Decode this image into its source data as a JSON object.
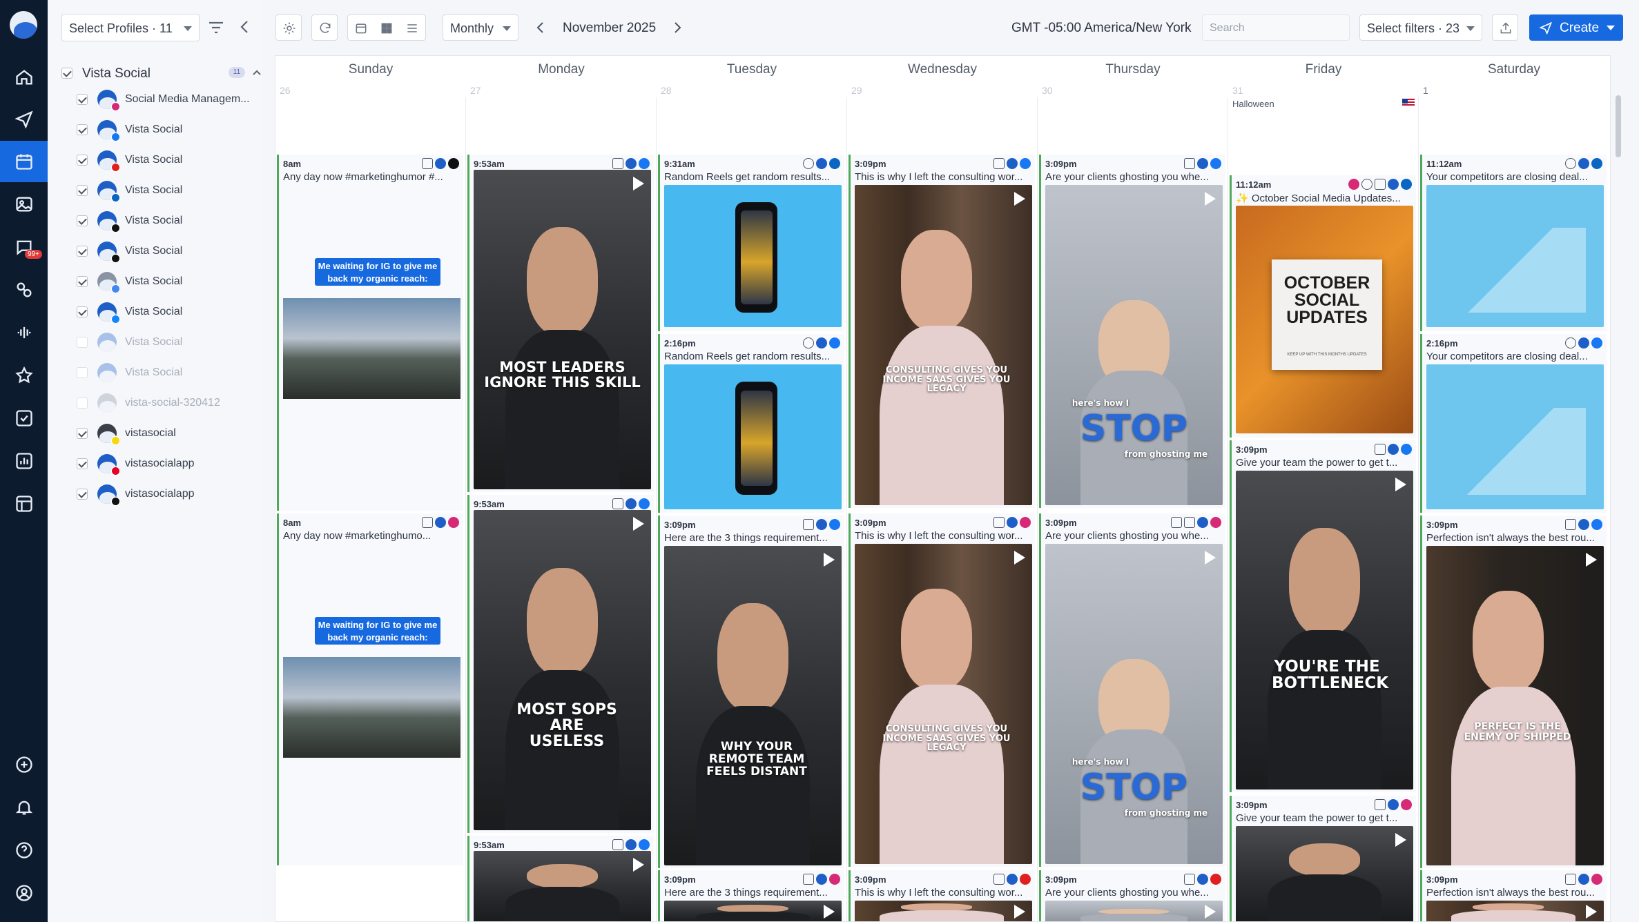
{
  "sidebar_nav": [
    {
      "icon": "home-icon"
    },
    {
      "icon": "send-icon"
    },
    {
      "icon": "calendar-icon",
      "active": true
    },
    {
      "icon": "media-library-icon"
    },
    {
      "icon": "inbox-icon",
      "badge": "99+"
    },
    {
      "icon": "integrations-icon"
    },
    {
      "icon": "listening-icon"
    },
    {
      "icon": "reviews-icon"
    },
    {
      "icon": "tasks-icon"
    },
    {
      "icon": "reports-icon"
    },
    {
      "icon": "workspace-icon"
    }
  ],
  "sidebar_bottom": [
    {
      "icon": "add-icon"
    },
    {
      "icon": "notifications-icon"
    },
    {
      "icon": "help-icon"
    },
    {
      "icon": "account-icon"
    }
  ],
  "profiles_panel": {
    "select_label": "Select Profiles · 11",
    "group": {
      "name": "Vista Social",
      "count": "11"
    },
    "profiles": [
      {
        "label": "Social Media Managem...",
        "checked": true,
        "network": "instagram"
      },
      {
        "label": "Vista Social",
        "checked": true,
        "network": "facebook"
      },
      {
        "label": "Vista Social",
        "checked": true,
        "network": "youtube"
      },
      {
        "label": "Vista Social",
        "checked": true,
        "network": "linkedin"
      },
      {
        "label": "Vista Social",
        "checked": true,
        "network": "x"
      },
      {
        "label": "Vista Social",
        "checked": true,
        "network": "tiktok"
      },
      {
        "label": "Vista Social",
        "checked": true,
        "network": "google"
      },
      {
        "label": "Vista Social",
        "checked": true,
        "network": "bluesky"
      },
      {
        "label": "Vista Social",
        "checked": false,
        "network": "threads"
      },
      {
        "label": "Vista Social",
        "checked": false,
        "network": "other"
      },
      {
        "label": "vista-social-320412",
        "checked": false,
        "network": "google"
      },
      {
        "label": "vistasocial",
        "checked": true,
        "network": "snapchat"
      },
      {
        "label": "vistasocialapp",
        "checked": true,
        "network": "pinterest"
      },
      {
        "label": "vistasocialapp",
        "checked": true,
        "network": "threads"
      }
    ]
  },
  "toolbar": {
    "view": "Monthly",
    "month": "November 2025",
    "timezone": "GMT -05:00 America/New York",
    "search_placeholder": "Search",
    "filters_label": "Select filters · 23",
    "create_label": "Create"
  },
  "calendar": {
    "days": [
      "Sunday",
      "Monday",
      "Tuesday",
      "Wednesday",
      "Thursday",
      "Friday",
      "Saturday"
    ],
    "day_numbers": [
      "26",
      "27",
      "28",
      "29",
      "30",
      "31",
      "1"
    ],
    "holiday": "Halloween",
    "posts": {
      "sunday": [
        {
          "time": "8am",
          "caption": "Any day now #marketinghumor #...",
          "meme_text": "Me waiting for IG to give me back my organic reach:"
        },
        {
          "time": "8am",
          "caption": "Any day now     #marketinghumo...",
          "meme_text": "Me waiting for IG to give me back my organic reach:"
        }
      ],
      "monday": [
        {
          "time": "9:53am",
          "overlay": "MOST LEADERS IGNORE THIS SKILL"
        },
        {
          "time": "9:53am",
          "overlay": "MOST SOPS ARE USELESS"
        },
        {
          "time": "9:53am",
          "overlay": ""
        }
      ],
      "tuesday": [
        {
          "time": "9:31am",
          "caption": "Random Reels get random results..."
        },
        {
          "time": "2:16pm",
          "caption": "Random Reels get random results..."
        },
        {
          "time": "3:09pm",
          "caption": "Here are the 3 things requirement...",
          "overlay": "WHY YOUR REMOTE TEAM FEELS DISTANT"
        },
        {
          "time": "3:09pm",
          "caption": "Here are the 3 things requirement..."
        }
      ],
      "wednesday": [
        {
          "time": "3:09pm",
          "caption": "This is why I left the consulting wor...",
          "overlay": "CONSULTING GIVES YOU INCOME SAAS GIVES YOU LEGACY"
        },
        {
          "time": "3:09pm",
          "caption": "This is why I left the consulting wor...",
          "overlay": "CONSULTING GIVES YOU INCOME SAAS GIVES YOU LEGACY"
        },
        {
          "time": "3:09pm",
          "caption": "This is why I left the consulting wor..."
        }
      ],
      "thursday": [
        {
          "time": "3:09pm",
          "caption": "Are your clients ghosting you whe...",
          "overlay": "STOP",
          "sub_top": "here's how I",
          "sub_bottom": "from ghosting me"
        },
        {
          "time": "3:09pm",
          "caption": "Are your clients ghosting you whe...",
          "overlay": "STOP",
          "sub_top": "here's how I",
          "sub_bottom": "from ghosting me"
        },
        {
          "time": "3:09pm",
          "caption": "Are your clients ghosting you whe..."
        }
      ],
      "friday": [
        {
          "time": "11:12am",
          "caption": "✨ October Social Media Updates...",
          "overlay": "OCTOBER SOCIAL UPDATES",
          "sub": "KEEP UP WITH THIS MONTHS UPDATES"
        },
        {
          "time": "3:09pm",
          "caption": "Give your team the power to get t...",
          "overlay": "YOU'RE THE BOTTLENECK"
        },
        {
          "time": "3:09pm",
          "caption": "Give your team the power to get t..."
        }
      ],
      "saturday": [
        {
          "time": "11:12am",
          "caption": "Your competitors are closing deal..."
        },
        {
          "time": "2:16pm",
          "caption": "Your competitors are closing deal..."
        },
        {
          "time": "3:09pm",
          "caption": "Perfection isn't always the best rou...",
          "overlay": "PERFECT IS THE ENEMY OF SHIPPED"
        },
        {
          "time": "3:09pm",
          "caption": "Perfection isn't always the best rou..."
        }
      ]
    }
  },
  "colors": {
    "accent": "#1769e0",
    "rail": "#0d1b2e",
    "post_border": "#4ea95b"
  }
}
